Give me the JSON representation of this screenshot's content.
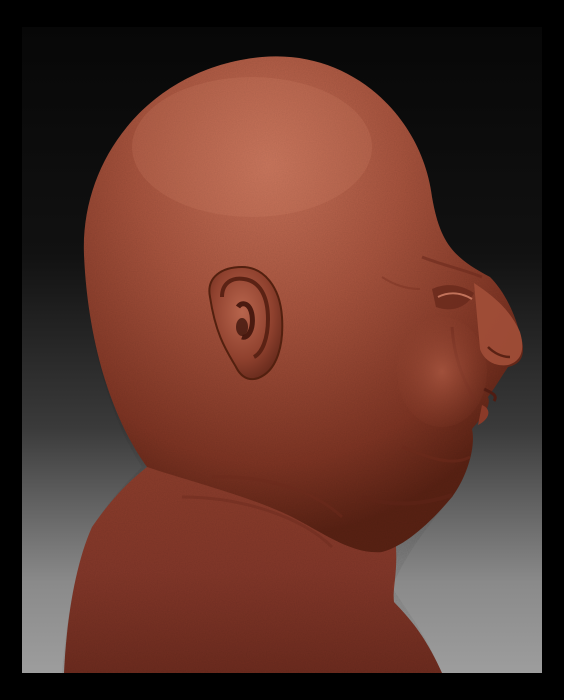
{
  "scene": {
    "subject": "sculpted-head-profile",
    "colors": {
      "outer_border": "#000000",
      "background_top": "#070707",
      "background_bottom": "#9d9d9d",
      "skin_base": "#9a4a36",
      "skin_highlight": "#c06a52",
      "skin_shadow": "#5c2216"
    }
  }
}
